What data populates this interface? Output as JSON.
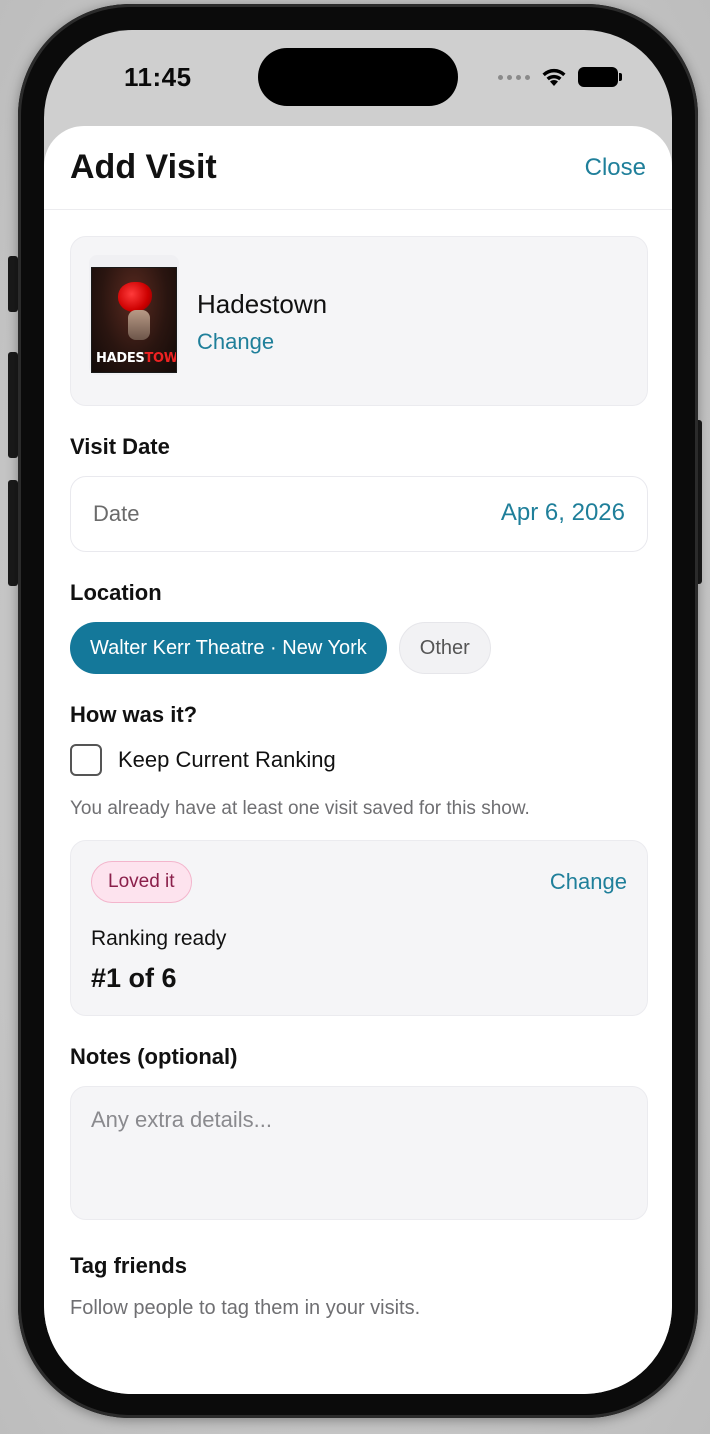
{
  "status_bar": {
    "time": "11:45",
    "icons": [
      "signal-dots-icon",
      "wifi-icon",
      "battery-icon"
    ]
  },
  "sheet": {
    "title": "Add Visit",
    "close_label": "Close"
  },
  "show": {
    "name": "Hadestown",
    "change_label": "Change",
    "poster_title_a": "HADES",
    "poster_title_b": "TOWN"
  },
  "visit_date": {
    "section_label": "Visit Date",
    "field_label": "Date",
    "value": "Apr 6, 2026"
  },
  "location": {
    "section_label": "Location",
    "options": [
      {
        "label": "Walter Kerr Theatre · New York",
        "selected": true
      },
      {
        "label": "Other",
        "selected": false
      }
    ]
  },
  "rating": {
    "section_label": "How was it?",
    "keep_ranking_label": "Keep Current Ranking",
    "keep_ranking_checked": false,
    "helper_text": "You already have at least one visit saved for this show.",
    "sentiment_badge": "Loved it",
    "change_label": "Change",
    "ranking_status": "Ranking ready",
    "ranking_value": "#1 of 6"
  },
  "notes": {
    "section_label": "Notes (optional)",
    "placeholder": "Any extra details...",
    "value": ""
  },
  "tag_friends": {
    "section_label": "Tag friends",
    "hint": "Follow people to tag them in your visits."
  },
  "colors": {
    "accent": "#1f7f9a",
    "chip_selected": "#14789a",
    "badge_bg": "#fde3ee",
    "badge_text": "#8a1f4a"
  }
}
